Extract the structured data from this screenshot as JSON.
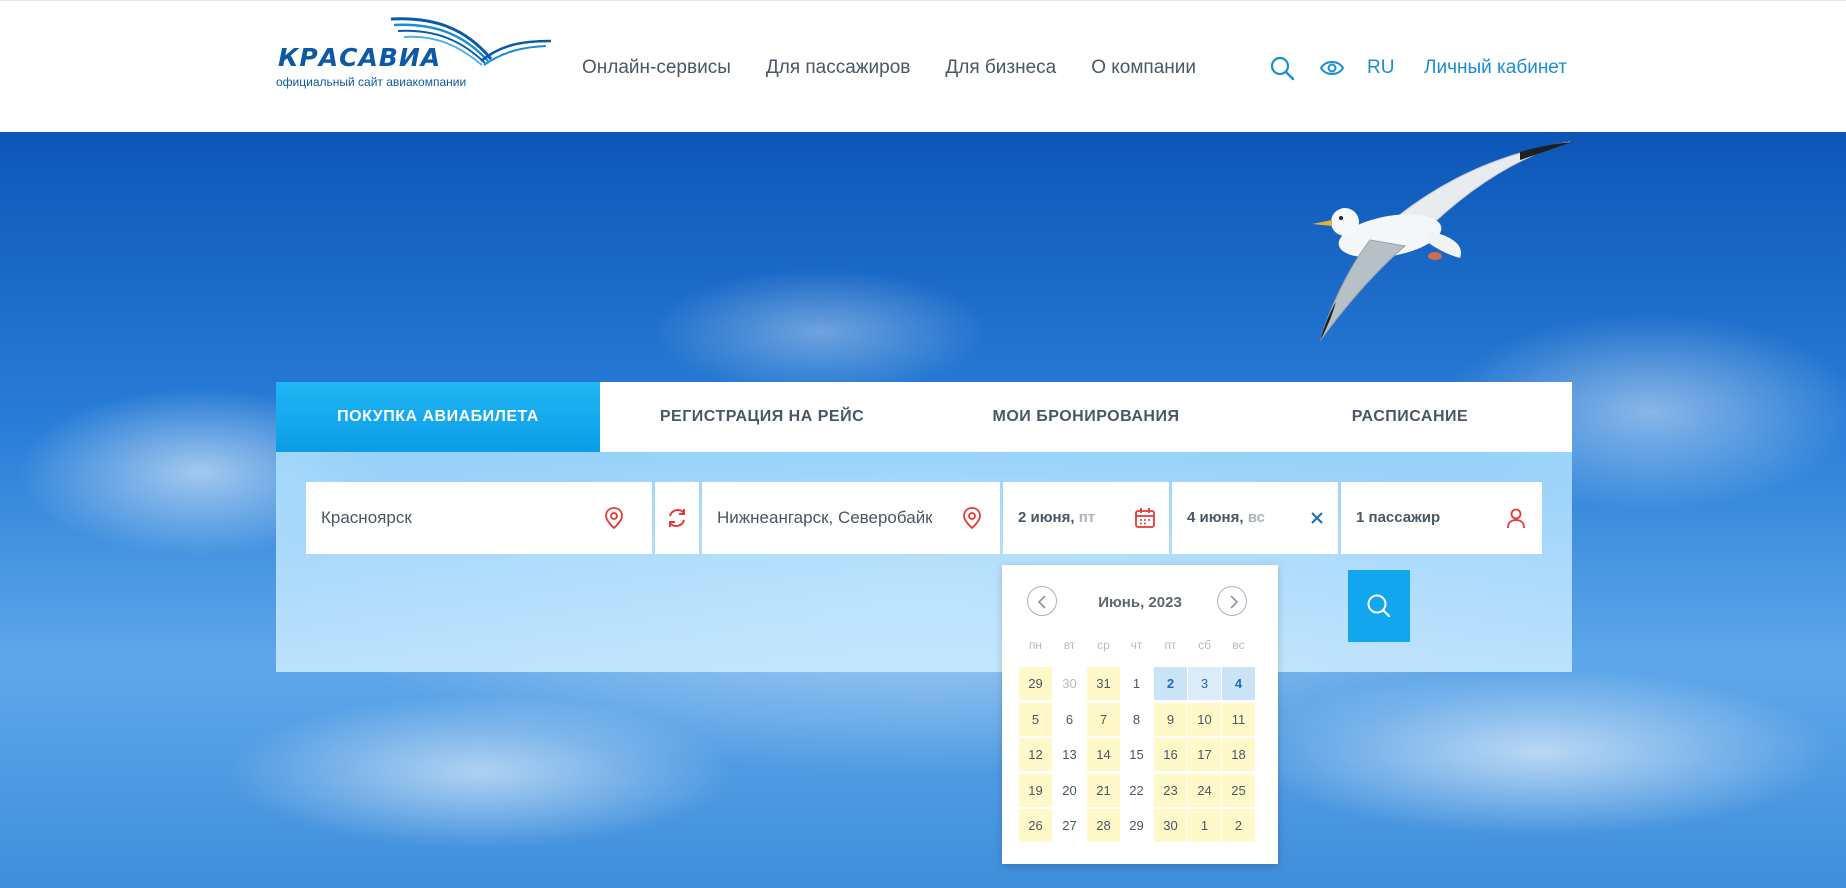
{
  "header": {
    "logo_title": "КРАСАВИА",
    "logo_subtitle": "официальный сайт авиакомпании",
    "nav": [
      "Онлайн-сервисы",
      "Для пассажиров",
      "Для бизнеса",
      "О компании"
    ],
    "lang": "RU",
    "cabinet": "Личный кабинет"
  },
  "tabs": [
    "ПОКУПКА АВИАБИЛЕТА",
    "РЕГИСТРАЦИЯ НА РЕЙС",
    "МОИ БРОНИРОВАНИЯ",
    "РАСПИСАНИЕ"
  ],
  "form": {
    "from": "Красноярск",
    "to": "Нижнеангарск, Северобайкальск",
    "date_out": "2 июня,",
    "date_out_dow": "пт",
    "date_back": "4 июня,",
    "date_back_dow": "вс",
    "passengers": "1 пассажир"
  },
  "calendar": {
    "month": "Июнь, 2023",
    "weekdays": [
      "пн",
      "вт",
      "ср",
      "чт",
      "пт",
      "сб",
      "вс"
    ],
    "weeks": [
      [
        {
          "d": "29",
          "s": "avail"
        },
        {
          "d": "30",
          "s": "other"
        },
        {
          "d": "31",
          "s": "avail"
        },
        {
          "d": "1",
          "s": ""
        },
        {
          "d": "2",
          "s": "sel"
        },
        {
          "d": "3",
          "s": "range"
        },
        {
          "d": "4",
          "s": "sel"
        }
      ],
      [
        {
          "d": "5",
          "s": "avail"
        },
        {
          "d": "6",
          "s": ""
        },
        {
          "d": "7",
          "s": "avail"
        },
        {
          "d": "8",
          "s": ""
        },
        {
          "d": "9",
          "s": "avail"
        },
        {
          "d": "10",
          "s": "avail"
        },
        {
          "d": "11",
          "s": "avail"
        }
      ],
      [
        {
          "d": "12",
          "s": "avail"
        },
        {
          "d": "13",
          "s": ""
        },
        {
          "d": "14",
          "s": "avail"
        },
        {
          "d": "15",
          "s": ""
        },
        {
          "d": "16",
          "s": "avail"
        },
        {
          "d": "17",
          "s": "avail"
        },
        {
          "d": "18",
          "s": "avail"
        }
      ],
      [
        {
          "d": "19",
          "s": "avail"
        },
        {
          "d": "20",
          "s": ""
        },
        {
          "d": "21",
          "s": "avail"
        },
        {
          "d": "22",
          "s": ""
        },
        {
          "d": "23",
          "s": "avail"
        },
        {
          "d": "24",
          "s": "avail"
        },
        {
          "d": "25",
          "s": "avail"
        }
      ],
      [
        {
          "d": "26",
          "s": "avail"
        },
        {
          "d": "27",
          "s": ""
        },
        {
          "d": "28",
          "s": "avail"
        },
        {
          "d": "29",
          "s": ""
        },
        {
          "d": "30",
          "s": "avail"
        },
        {
          "d": "1",
          "s": "avail"
        },
        {
          "d": "2",
          "s": "avail"
        }
      ]
    ]
  },
  "colors": {
    "brand_blue": "#0c5aa6",
    "accent_blue": "#1a8fd0",
    "active_tab": "#11a6ee",
    "icon_red": "#e53935"
  }
}
